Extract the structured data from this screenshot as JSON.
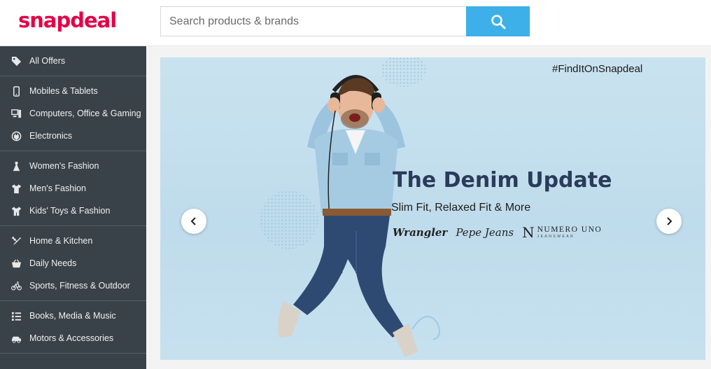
{
  "header": {
    "logo": "snapdeal",
    "search_placeholder": "Search products & brands",
    "colors": {
      "brand": "#e40046",
      "search_button": "#3db0ea"
    }
  },
  "sidebar": {
    "groups": [
      [
        {
          "label": "All Offers",
          "icon": "tag-icon"
        }
      ],
      [
        {
          "label": "Mobiles & Tablets",
          "icon": "mobile-icon"
        },
        {
          "label": "Computers, Office & Gaming",
          "icon": "computer-icon"
        },
        {
          "label": "Electronics",
          "icon": "electronics-icon"
        }
      ],
      [
        {
          "label": "Women's Fashion",
          "icon": "dress-icon"
        },
        {
          "label": "Men's Fashion",
          "icon": "tshirt-icon"
        },
        {
          "label": "Kids' Toys & Fashion",
          "icon": "kids-icon"
        }
      ],
      [
        {
          "label": "Home & Kitchen",
          "icon": "kitchen-icon"
        },
        {
          "label": "Daily Needs",
          "icon": "basket-icon"
        },
        {
          "label": "Sports, Fitness & Outdoor",
          "icon": "bicycle-icon"
        }
      ],
      [
        {
          "label": "Books, Media & Music",
          "icon": "books-icon"
        },
        {
          "label": "Motors & Accessories",
          "icon": "car-icon"
        }
      ]
    ]
  },
  "banner": {
    "hashtag": "#FindItOnSnapdeal",
    "headline": "The Denim Update",
    "subline": "Slim Fit, Relaxed Fit & More",
    "brands": {
      "wrangler": "Wrangler",
      "pepe": "Pepe Jeans",
      "nu_mark": "N",
      "nu_name": "NUMERO UNO",
      "nu_sub": "JEANSWEAR"
    },
    "headline_color": "#2b3b5a"
  }
}
